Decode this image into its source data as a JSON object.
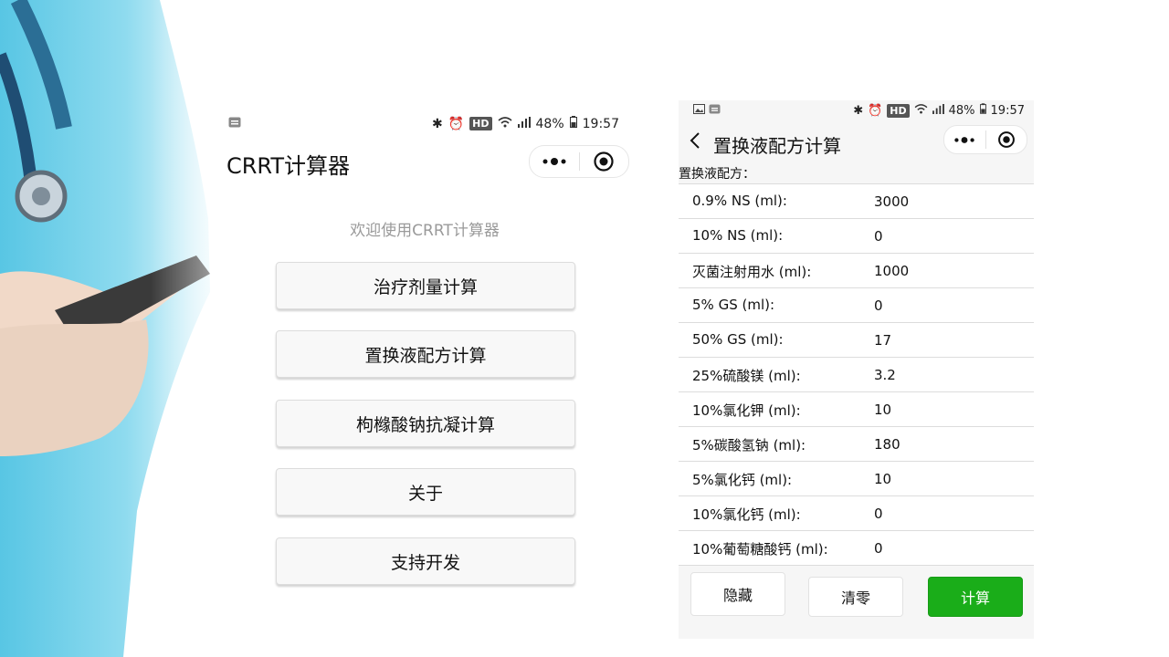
{
  "phone1": {
    "status": {
      "hd": "HD",
      "battery": "48%",
      "time": "19:57"
    },
    "title": "CRRT计算器",
    "welcome": "欢迎使用CRRT计算器",
    "menu": [
      {
        "label": "治疗剂量计算"
      },
      {
        "label": "置换液配方计算"
      },
      {
        "label": "枸橼酸钠抗凝计算"
      },
      {
        "label": "关于"
      },
      {
        "label": "支持开发"
      }
    ]
  },
  "phone2": {
    "status": {
      "hd": "HD",
      "battery": "48%",
      "time": "19:57"
    },
    "title": "置换液配方计算",
    "back_label": "<",
    "section_label": "置换液配方：",
    "fields": [
      {
        "label": "0.9% NS (ml):",
        "value": "3000"
      },
      {
        "label": "10% NS (ml):",
        "value": "0"
      },
      {
        "label": "灭菌注射用水 (ml):",
        "value": "1000"
      },
      {
        "label": "5% GS (ml):",
        "value": "0"
      },
      {
        "label": "50% GS (ml):",
        "value": "17"
      },
      {
        "label": "25%硫酸镁 (ml):",
        "value": "3.2"
      },
      {
        "label": "10%氯化钾 (ml):",
        "value": "10"
      },
      {
        "label": "5%碳酸氢钠 (ml):",
        "value": "180"
      },
      {
        "label": "5%氯化钙 (ml):",
        "value": "10"
      },
      {
        "label": "10%氯化钙 (ml):",
        "value": "0"
      },
      {
        "label": "10%葡萄糖酸钙 (ml):",
        "value": "0"
      }
    ],
    "buttons": {
      "hide": "隐藏",
      "clear": "清零",
      "calc": "计算"
    }
  },
  "colors": {
    "primary_green": "#1aad19",
    "welcome_gray": "#9a9a9a"
  }
}
